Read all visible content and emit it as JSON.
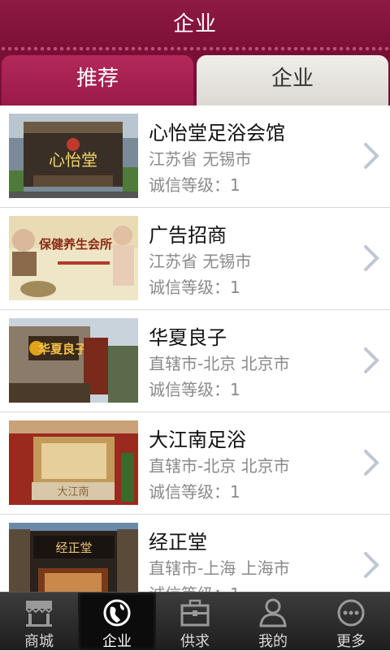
{
  "header": {
    "title": "企业"
  },
  "tabs": [
    {
      "label": "推荐",
      "active": true
    },
    {
      "label": "企业",
      "active": false
    }
  ],
  "list": [
    {
      "name": "心怡堂足浴会馆",
      "location": "江苏省 无锡市",
      "grade": "诚信等级：1",
      "image_text": "心怡堂"
    },
    {
      "name": "广告招商",
      "location": "江苏省 无锡市",
      "grade": "诚信等级：1",
      "image_text": "保健养生会所"
    },
    {
      "name": "华夏良子",
      "location": "直辖市-北京 北京市",
      "grade": "诚信等级：1",
      "image_text": "华夏良子"
    },
    {
      "name": "大江南足浴",
      "location": "直辖市-北京 北京市",
      "grade": "诚信等级：1",
      "image_text": "大江南"
    },
    {
      "name": "经正堂",
      "location": "直辖市-上海 上海市",
      "grade": "诚信等级：1",
      "image_text": "经正堂"
    }
  ],
  "tabbar": [
    {
      "label": "商城",
      "icon": "store-icon",
      "active": false
    },
    {
      "label": "企业",
      "icon": "globe-icon",
      "active": true
    },
    {
      "label": "供求",
      "icon": "briefcase-icon",
      "active": false
    },
    {
      "label": "我的",
      "icon": "person-icon",
      "active": false
    },
    {
      "label": "更多",
      "icon": "more-icon",
      "active": false
    }
  ],
  "colors": {
    "accent": "#8e1a44",
    "tab_active": "#b3285a",
    "tabbar": "#2a2a2a"
  }
}
